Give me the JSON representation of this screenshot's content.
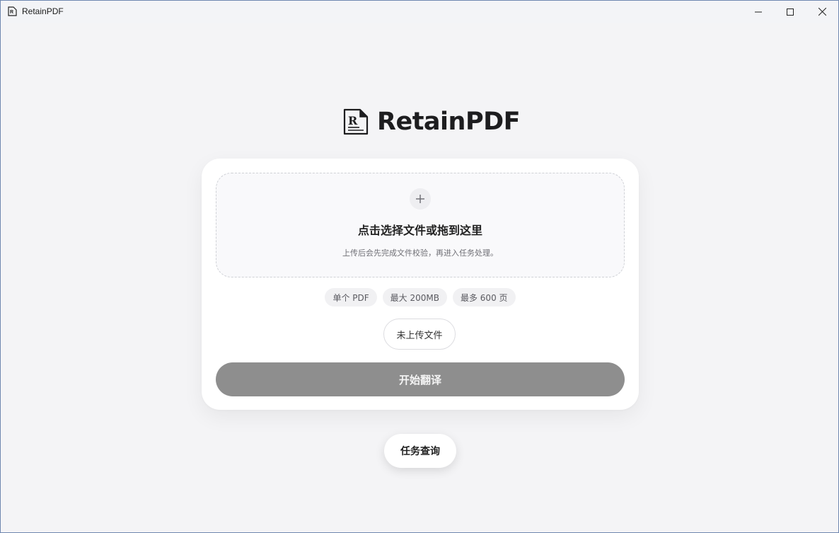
{
  "window": {
    "title": "RetainPDF"
  },
  "window_controls": {
    "minimize_icon": "minimize-icon",
    "maximize_icon": "maximize-icon",
    "close_icon": "close-icon"
  },
  "brand": {
    "name": "RetainPDF",
    "logo_icon": "document-r-logo-icon"
  },
  "upload": {
    "plus_icon": "plus-icon",
    "title": "点击选择文件或拖到这里",
    "hint": "上传后会先完成文件校验，再进入任务处理。"
  },
  "limits": [
    "单个 PDF",
    "最大 200MB",
    "最多 600 页"
  ],
  "file_status": "未上传文件",
  "start_button": {
    "label": "开始翻译",
    "color": "#8e8e8e"
  },
  "query_button": {
    "label": "任务查询"
  }
}
